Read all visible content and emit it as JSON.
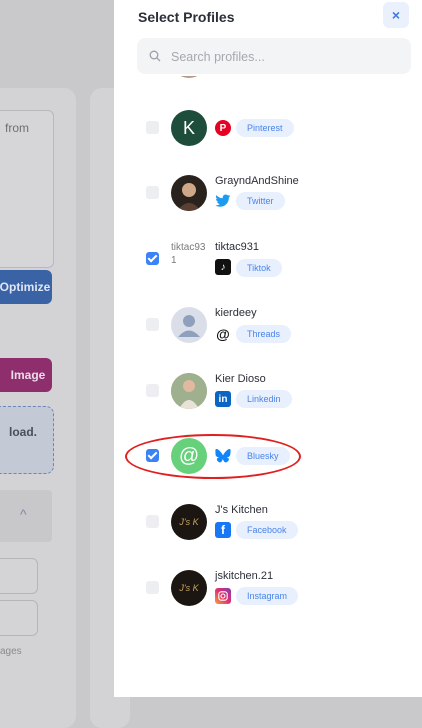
{
  "background": {
    "textarea_text": "from",
    "optimize_label": "Optimize",
    "image_label": "Image",
    "upload_text": "load.",
    "ages_text": "ages",
    "chevron": "^"
  },
  "modal": {
    "title": "Select Profiles",
    "close_label": "×",
    "search_placeholder": "Search profiles..."
  },
  "profiles": [
    {
      "name": "",
      "platform": "Pinterest",
      "checked": false,
      "avatar_letter": "K",
      "icon": "pinterest-icon"
    },
    {
      "name": "GrayndAndShine",
      "platform": "Twitter",
      "checked": false,
      "icon": "twitter-icon"
    },
    {
      "name": "tiktac931",
      "platform": "Tiktok",
      "checked": true,
      "avatar_alt": "tiktac931",
      "icon": "tiktok-icon"
    },
    {
      "name": "kierdeey",
      "platform": "Threads",
      "checked": false,
      "icon": "threads-icon"
    },
    {
      "name": "Kier Dioso",
      "platform": "Linkedin",
      "checked": false,
      "icon": "linkedin-icon"
    },
    {
      "name": "",
      "platform": "Bluesky",
      "checked": true,
      "avatar_letter": "@",
      "icon": "bluesky-icon"
    },
    {
      "name": "J's Kitchen",
      "platform": "Facebook",
      "checked": false,
      "icon": "facebook-icon"
    },
    {
      "name": "jskitchen.21",
      "platform": "Instagram",
      "checked": false,
      "icon": "instagram-icon"
    }
  ],
  "colors": {
    "accent": "#3b82f6",
    "badge_bg": "#e8f0fd",
    "badge_text": "#4a84ea",
    "annotation": "#e0201f"
  }
}
